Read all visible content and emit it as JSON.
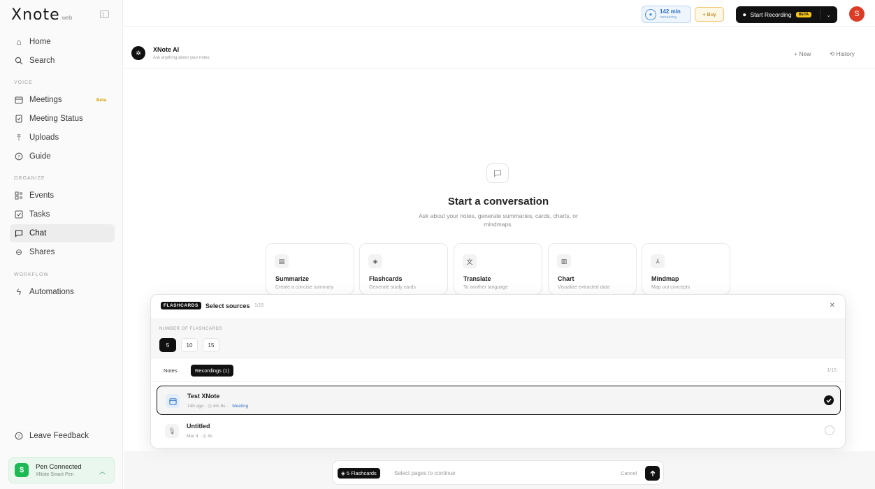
{
  "brand": {
    "name": "Xnote",
    "sub": "web"
  },
  "sidebar": {
    "top_items": [
      {
        "label": "Home",
        "icon": "home-icon"
      },
      {
        "label": "Search",
        "icon": "search-icon"
      }
    ],
    "voice_label": "VOICE",
    "voice_items": [
      {
        "label": "Meetings",
        "icon": "calendar-icon",
        "badge": "Beta"
      },
      {
        "label": "Meeting Status",
        "icon": "status-icon"
      },
      {
        "label": "Uploads",
        "icon": "upload-icon"
      },
      {
        "label": "Guide",
        "icon": "help-icon"
      }
    ],
    "organize_label": "ORGANIZE",
    "organize_items": [
      {
        "label": "Events",
        "icon": "events-icon"
      },
      {
        "label": "Tasks",
        "icon": "tasks-icon"
      },
      {
        "label": "Chat",
        "icon": "chat-icon",
        "active": true
      },
      {
        "label": "Shares",
        "icon": "link-icon"
      }
    ],
    "workflow_label": "WORKFLOW",
    "workflow_items": [
      {
        "label": "Automations",
        "icon": "automation-icon"
      }
    ],
    "feedback": "Leave Feedback",
    "pen": {
      "title": "Pen Connected",
      "sub": "XNote Smart Pen"
    }
  },
  "topbar": {
    "minutes_value": "142 min",
    "minutes_sub": "remaining",
    "buy_label": "+ Buy",
    "record_label": "Start Recording",
    "record_badge": "BETA",
    "avatar_initial": "S"
  },
  "chat_header": {
    "title": "XNote AI",
    "subtitle": "Ask anything about your notes",
    "new_label": "+ New",
    "history_label": "History"
  },
  "empty": {
    "title": "Start a conversation",
    "subtitle": "Ask about your notes, generate summaries, cards, charts, or mindmaps."
  },
  "actions": [
    {
      "title": "Summarize",
      "sub": "Create a concise summary",
      "icon": "document-icon"
    },
    {
      "title": "Flashcards",
      "sub": "Generate study cards",
      "icon": "layers-icon"
    },
    {
      "title": "Translate",
      "sub": "To another language",
      "icon": "translate-icon"
    },
    {
      "title": "Chart",
      "sub": "Visualize extracted data",
      "icon": "chart-icon"
    },
    {
      "title": "Mindmap",
      "sub": "Map out concepts",
      "icon": "mindmap-icon"
    }
  ],
  "panel": {
    "tag": "FLASHCARDS",
    "title": "Select sources",
    "count": "1/15",
    "num_label": "NUMBER OF FLASHCARDS",
    "num_options": [
      "5",
      "10",
      "15"
    ],
    "selected_num": "5",
    "tabs": [
      "Notes",
      "Recordings (1)"
    ],
    "active_tab": "Recordings (1)",
    "tab_count": "1/15",
    "rows": [
      {
        "title": "Test XNote",
        "meta": "14h ago · ◷ 4m 6s ·",
        "tag": "Meeting",
        "selected": true
      },
      {
        "title": "Untitled",
        "meta": "Mar 4 · ◷ 3s",
        "tag": "",
        "selected": false
      }
    ]
  },
  "composer": {
    "tag": "5 Flashcards",
    "placeholder": "Select pages to continue",
    "cancel": "Cancel"
  }
}
